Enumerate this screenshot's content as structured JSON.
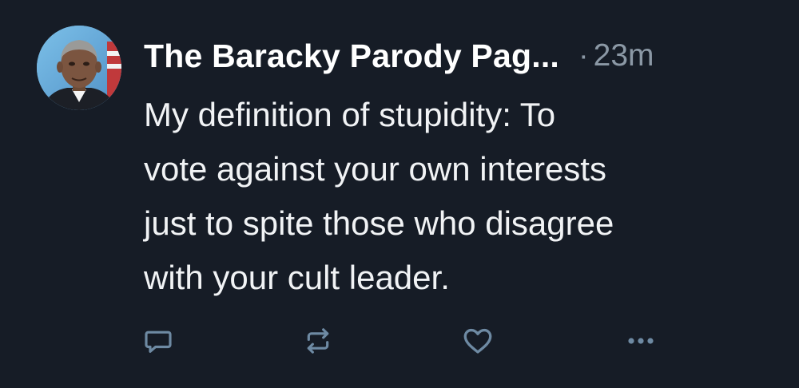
{
  "post": {
    "author": "The Baracky Parody Pag...",
    "separator": "·",
    "time": "23m",
    "text_lines": [
      "My definition of stupidity: To",
      "vote against your own interests",
      "just to spite those who disagree",
      "with your cult leader."
    ]
  },
  "actions": {
    "reply_icon": "reply-icon",
    "repost_icon": "repost-icon",
    "like_icon": "heart-icon",
    "more_icon": "more-icon"
  },
  "colors": {
    "background": "#161c26",
    "text": "#f1f3f5",
    "secondary": "#8b98a5",
    "icon": "#6e8aa3"
  }
}
